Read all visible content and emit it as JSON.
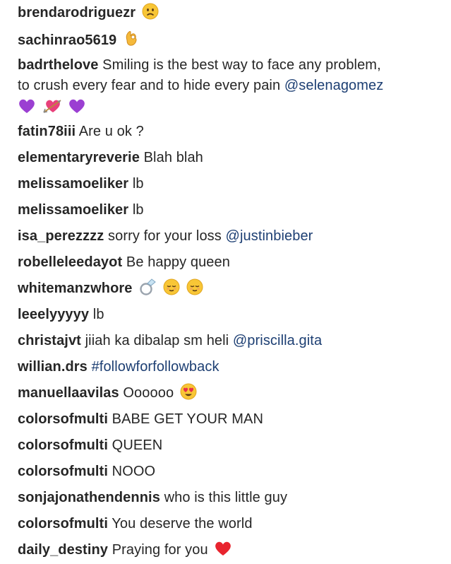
{
  "comments": [
    {
      "user": "brendarodriguezr",
      "text": "",
      "emojis": [
        "frowning-face"
      ]
    },
    {
      "user": "sachinrao5619",
      "text": "",
      "emojis": [
        "ok-hand"
      ]
    },
    {
      "user": "badrthelove",
      "text": "Smiling is the best way to face any problem,",
      "text2": "to crush every fear and to hide every pain",
      "mention": "@selenagomez",
      "emojis": [
        "purple-heart",
        "heart-with-arrow",
        "purple-heart"
      ]
    },
    {
      "user": "fatin78iii",
      "text": "Are u ok ?"
    },
    {
      "user": "elementaryreverie",
      "text": "Blah blah"
    },
    {
      "user": "melissamoeliker",
      "text": "lb"
    },
    {
      "user": "melissamoeliker",
      "text": "lb"
    },
    {
      "user": "isa_perezzzz",
      "text": "sorry for your loss",
      "mention": "@justinbieber"
    },
    {
      "user": "robelleleedayot",
      "text": "Be happy queen"
    },
    {
      "user": "whitemanzwhore",
      "text": "",
      "emojis": [
        "ring",
        "relieved-face",
        "relieved-face"
      ]
    },
    {
      "user": "leeelyyyyy",
      "text": "lb"
    },
    {
      "user": "christajvt",
      "text": "jiiah ka dibalap sm heli",
      "mention": "@priscilla.gita"
    },
    {
      "user": "willian.drs",
      "text": "",
      "hashtag": "#followforfollowback"
    },
    {
      "user": "manuellaavilas",
      "text": "Oooooo",
      "emojis": [
        "heart-eyes-face"
      ]
    },
    {
      "user": "colorsofmulti",
      "text": "BABE GET YOUR MAN"
    },
    {
      "user": "colorsofmulti",
      "text": "QUEEN"
    },
    {
      "user": "colorsofmulti",
      "text": "NOOO"
    },
    {
      "user": "sonjajonathendennis",
      "text": "who is this little guy"
    },
    {
      "user": "colorsofmulti",
      "text": "You deserve the world"
    },
    {
      "user": "daily_destiny",
      "text": "Praying for you",
      "emojis": [
        "red-heart"
      ]
    }
  ]
}
